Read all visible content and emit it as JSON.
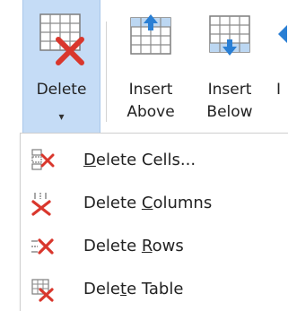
{
  "ribbon": {
    "delete": {
      "label": "Delete",
      "caret": "▾"
    },
    "insert_above": {
      "line1": "Insert",
      "line2": "Above"
    },
    "insert_below": {
      "line1": "Insert",
      "line2": "Below"
    },
    "insert_left": {
      "line1": "I"
    }
  },
  "menu": {
    "items": [
      {
        "pre": "",
        "u": "D",
        "post": "elete Cells..."
      },
      {
        "pre": "Delete ",
        "u": "C",
        "post": "olumns"
      },
      {
        "pre": "Delete ",
        "u": "R",
        "post": "ows"
      },
      {
        "pre": "Dele",
        "u": "t",
        "post": "e Table"
      }
    ]
  },
  "colors": {
    "accent_red": "#d9372d",
    "accent_blue": "#2a7fd4",
    "selected_bg": "#c5dcf6",
    "grid_gray": "#8a8a8a"
  }
}
